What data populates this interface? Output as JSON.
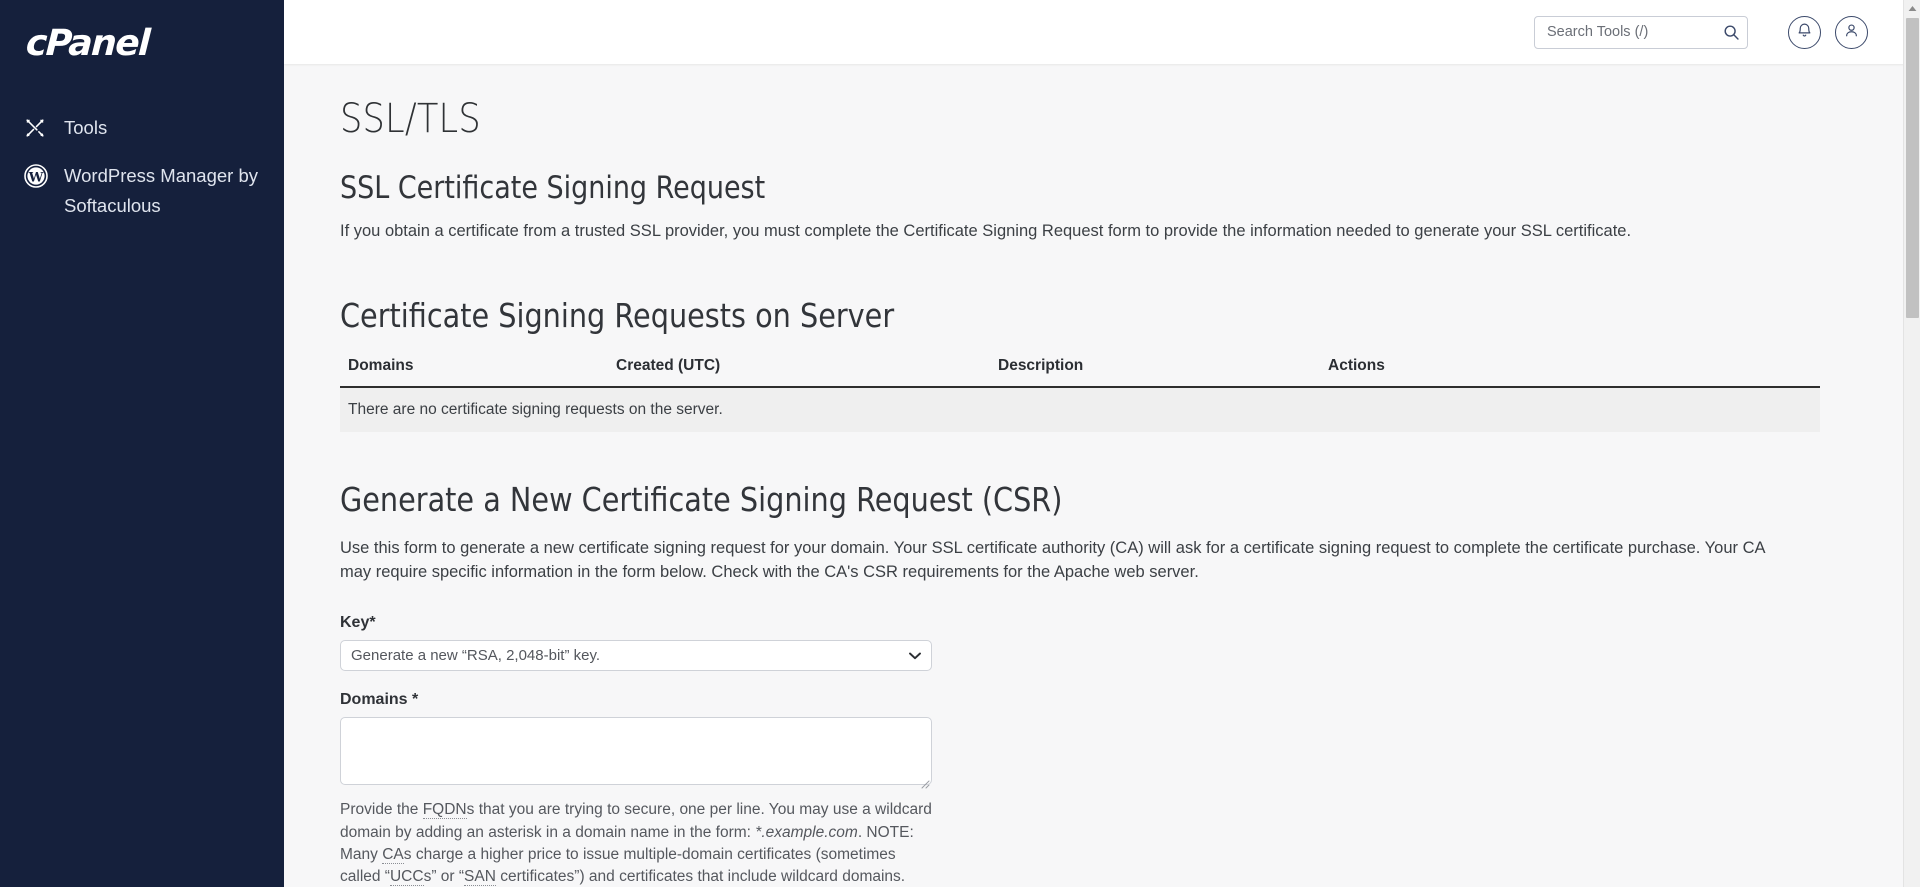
{
  "sidebar": {
    "logo_text": "cPanel",
    "items": [
      {
        "label": "Tools",
        "icon": "tools-icon"
      },
      {
        "label": "WordPress Manager by Softaculous",
        "icon": "wordpress-icon"
      }
    ]
  },
  "topbar": {
    "search_placeholder": "Search Tools (/)",
    "search_value": "",
    "search_icon": "search-icon",
    "notifications_icon": "bell-icon",
    "account_icon": "user-icon"
  },
  "page": {
    "title": "SSL/TLS",
    "csr_section": {
      "heading": "SSL Certificate Signing Request",
      "description": "If you obtain a certificate from a trusted SSL provider, you must complete the Certificate Signing Request form to provide the information needed to generate your SSL certificate."
    },
    "table_section": {
      "heading": "Certificate Signing Requests on Server",
      "columns": [
        "Domains",
        "Created (UTC)",
        "Description",
        "Actions"
      ],
      "empty_message": "There are no certificate signing requests on the server."
    },
    "generate_section": {
      "heading": "Generate a New Certificate Signing Request (CSR)",
      "description": "Use this form to generate a new certificate signing request for your domain. Your SSL certificate authority (CA) will ask for a certificate signing request to complete the certificate purchase. Your CA may require specific information in the form below. Check with the CA's CSR requirements for the Apache web server.",
      "key_label": "Key*",
      "key_selected": "Generate a new “RSA, 2,048-bit” key.",
      "key_options": [
        "Generate a new “RSA, 2,048-bit” key."
      ],
      "domains_label": "Domains *",
      "domains_value": "",
      "help": {
        "p1": "Provide the ",
        "abbr1": "FQDN",
        "p2": "s that you are trying to secure, one per line. You may use a wildcard domain by adding an asterisk in a domain name in the form: ",
        "example": "*.example.com",
        "p3": ". NOTE: Many ",
        "abbr2": "CA",
        "p4": "s charge a higher price to issue multiple-domain certificates (sometimes called “",
        "abbr3": "UCC",
        "p5": "s” or “",
        "abbr4": "SAN",
        "p6": " certificates”) and certificates that include wildcard domains."
      }
    }
  },
  "colors": {
    "sidebar_bg": "#15203c",
    "content_bg": "#f7f7f8",
    "accent": "#3c4a6b",
    "empty_row_bg": "#efefef"
  }
}
